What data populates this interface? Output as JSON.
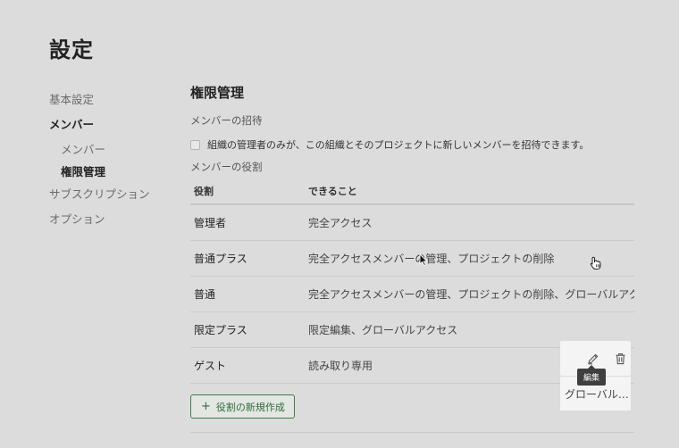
{
  "page": {
    "title": "設定"
  },
  "sidebar": {
    "items": [
      {
        "label": "基本設定"
      },
      {
        "label": "メンバー"
      },
      {
        "label": "メンバー"
      },
      {
        "label": "権限管理"
      },
      {
        "label": "サブスクリプション"
      },
      {
        "label": "オプション"
      }
    ]
  },
  "main": {
    "section_title": "権限管理",
    "invite": {
      "heading": "メンバーの招待",
      "checkbox_label": "組織の管理者のみが、この組織とそのプロジェクトに新しいメンバーを招待できます。",
      "checked": false
    },
    "roles": {
      "heading": "メンバーの役割",
      "columns": [
        "役割",
        "できること"
      ],
      "rows": [
        {
          "role": "管理者",
          "permissions": "完全アクセス"
        },
        {
          "role": "普通プラス",
          "permissions": "完全アクセスメンバーの管理、プロジェクトの削除"
        },
        {
          "role": "普通",
          "permissions": "完全アクセスメンバーの管理、プロジェクトの削除、グローバルアクセス"
        },
        {
          "role": "限定プラス",
          "permissions": "限定編集、グローバルアクセス"
        },
        {
          "role": "ゲスト",
          "permissions": "読み取り専用"
        }
      ],
      "truncated_text": "グローバル…",
      "actions": {
        "edit_icon": "pencil-icon",
        "delete_icon": "trash-icon",
        "edit_tooltip": "編集"
      },
      "new_role_icon": "plus-icon",
      "new_role_label": "役割の新規作成"
    }
  },
  "colors": {
    "background": "#dcdcdc",
    "accent_green": "#2f6e3b",
    "tooltip_bg": "#3f3f3f"
  }
}
